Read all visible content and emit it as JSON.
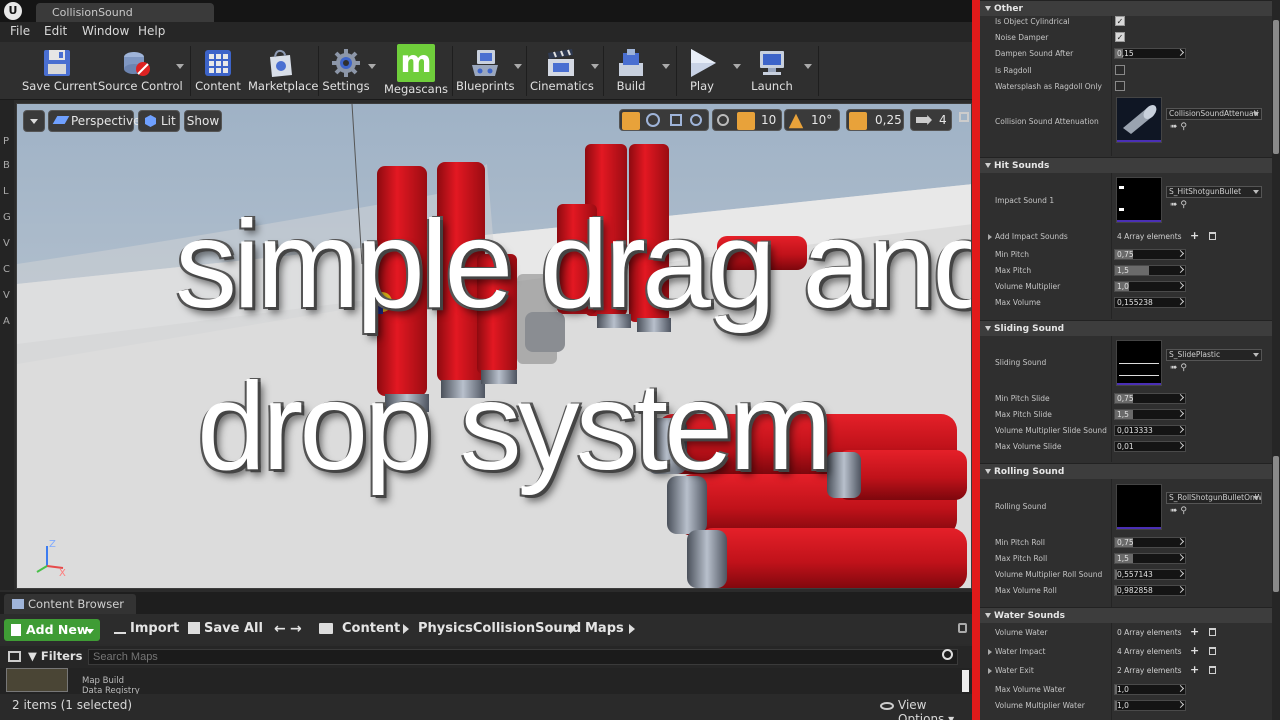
{
  "window": {
    "tab_title": "CollisionSound",
    "logo": "U"
  },
  "menu": [
    "File",
    "Edit",
    "Window",
    "Help"
  ],
  "toolbar": {
    "save_current": "Save Current",
    "source_control": "Source Control",
    "content": "Content",
    "marketplace": "Marketplace",
    "settings": "Settings",
    "megascans": "Megascans",
    "blueprints": "Blueprints",
    "cinematics": "Cinematics",
    "build": "Build",
    "play": "Play",
    "launch": "Launch"
  },
  "left_strip": [
    "P",
    "B",
    "L",
    "G",
    "V",
    "C",
    "V",
    "A"
  ],
  "viewport": {
    "perspective": "Perspective",
    "lit": "Lit",
    "show": "Show",
    "grid_snap": "10",
    "rotation_snap": "10°",
    "scale_snap": "0,25",
    "camera_speed": "4",
    "overlay_line1": "simple drag and",
    "overlay_line2": "drop system",
    "axis_z": "Z",
    "axis_x": "X"
  },
  "content_browser": {
    "tab": "Content Browser",
    "add_new": "Add New",
    "import": "Import",
    "save_all": "Save All",
    "path": [
      "Content",
      "PhysicsCollisionSound",
      "Maps"
    ],
    "filters": "Filters",
    "search_placeholder": "Search Maps",
    "asset_name": "Map Build",
    "asset_sub": "Data Registry",
    "status": "2 items (1 selected)",
    "view_options": "View Options"
  },
  "details": {
    "other": {
      "title": "Other",
      "is_object_cylindrical": "Is Object Cylindrical",
      "noise_damper": "Noise Damper",
      "dampen_sound_after": "Dampen Sound After",
      "dampen_sound_after_value": "0,15",
      "is_ragdoll": "Is Ragdoll",
      "watersplash": "Watersplash as Ragdoll Only",
      "attenuation": "Collision Sound Attenuation",
      "attenuation_asset": "CollisionSoundAttenuati"
    },
    "hit": {
      "title": "Hit Sounds",
      "impact_sound_1": "Impact Sound 1",
      "impact_asset": "S_HitShotgunBullet",
      "add_impact_sounds": "Add Impact Sounds",
      "add_impact_count": "4 Array elements",
      "min_pitch": "Min Pitch",
      "min_pitch_value": "0,75",
      "max_pitch": "Max Pitch",
      "max_pitch_value": "1,5",
      "volume_multiplier": "Volume Multiplier",
      "volume_multiplier_value": "1,0",
      "max_volume": "Max Volume",
      "max_volume_value": "0,155238"
    },
    "sliding": {
      "title": "Sliding Sound",
      "sliding_sound": "Sliding Sound",
      "asset": "S_SlidePlastic",
      "min_pitch": "Min Pitch Slide",
      "min_pitch_value": "0,75",
      "max_pitch": "Max Pitch Slide",
      "max_pitch_value": "1,5",
      "volume_mult": "Volume Multiplier Slide Sound",
      "volume_mult_value": "0,013333",
      "max_volume": "Max Volume Slide",
      "max_volume_value": "0,01"
    },
    "rolling": {
      "title": "Rolling Sound",
      "rolling_sound": "Rolling Sound",
      "asset": "S_RollShotgunBulletOnW",
      "min_pitch": "Min Pitch Roll",
      "min_pitch_value": "0,75",
      "max_pitch": "Max Pitch Roll",
      "max_pitch_value": "1,5",
      "volume_mult": "Volume Multiplier Roll Sound",
      "volume_mult_value": "0,557143",
      "max_volume": "Max Volume Roll",
      "max_volume_value": "0,982858"
    },
    "water": {
      "title": "Water Sounds",
      "volume_water": "Volume Water",
      "volume_water_count": "0 Array elements",
      "water_impact": "Water Impact",
      "water_impact_count": "4 Array elements",
      "water_exit": "Water Exit",
      "water_exit_count": "2 Array elements",
      "max_volume_water": "Max Volume Water",
      "max_volume_water_value": "1,0",
      "volume_mult_water": "Volume Multiplier Water",
      "volume_mult_water_value": "1,0"
    }
  },
  "colors": {
    "accent_green": "#3f9c35",
    "divider_red": "#e11a1a",
    "actor_red": "#d8101a"
  }
}
